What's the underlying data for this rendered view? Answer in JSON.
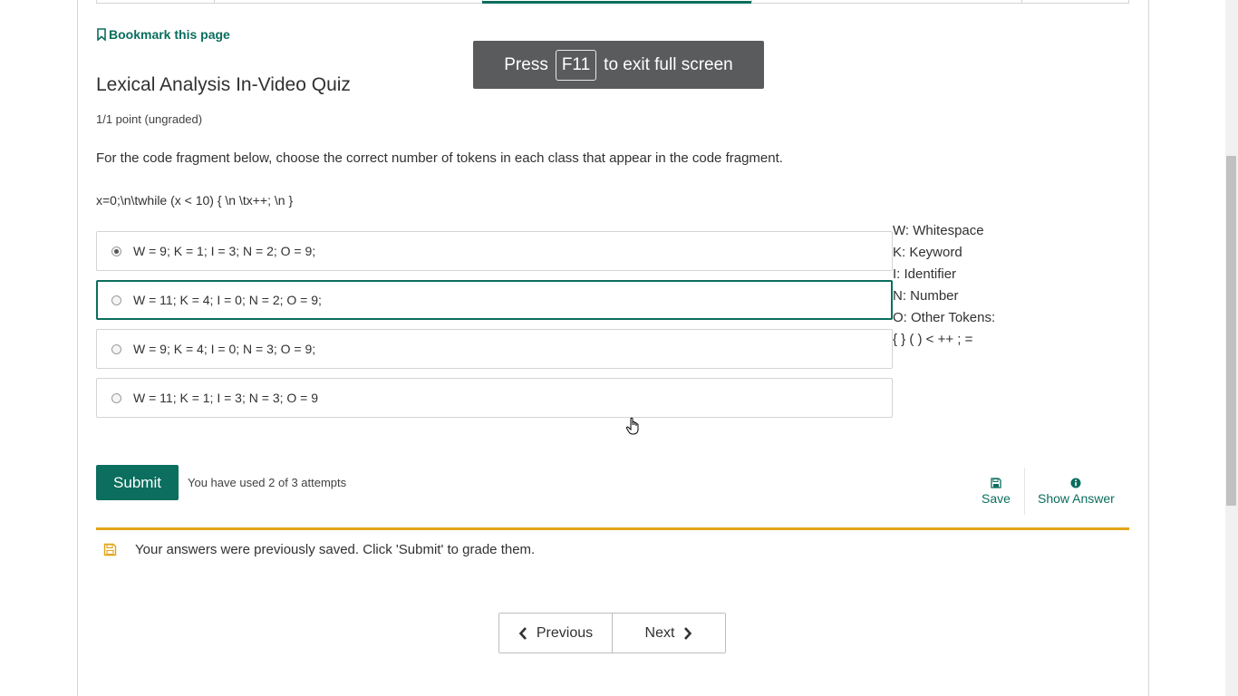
{
  "bookmark": {
    "label": "Bookmark this page"
  },
  "fullscreen_toast": {
    "before": "Press",
    "key": "F11",
    "after": "to exit full screen"
  },
  "quiz": {
    "title": "Lexical Analysis In-Video Quiz",
    "points": "1/1 point (ungraded)",
    "prompt": "For the code fragment below, choose the correct number of tokens in each class that appear in the code fragment.",
    "code": "x=0;\\n\\twhile (x < 10) { \\n \\tx++; \\n }",
    "options": [
      {
        "label": "W = 9; K = 1; I = 3; N = 2; O = 9;",
        "checked": true
      },
      {
        "label": "W = 11; K = 4; I = 0; N = 2; O = 9;",
        "checked": false
      },
      {
        "label": "W = 9; K = 4; I = 0; N = 3; O = 9;",
        "checked": false
      },
      {
        "label": "W = 11; K = 1; I = 3; N = 3; O = 9",
        "checked": false
      }
    ],
    "legend": [
      "W: Whitespace",
      "K: Keyword",
      "I: Identifier",
      "N: Number",
      "O: Other Tokens:",
      "{ } ( ) < ++ ; ="
    ]
  },
  "actions": {
    "submit_label": "Submit",
    "attempts_text": "You have used 2 of 3 attempts",
    "save_label": "Save",
    "show_answer_label": "Show Answer"
  },
  "notice": {
    "text": "Your answers were previously saved. Click 'Submit' to grade them."
  },
  "navigation": {
    "previous_label": "Previous",
    "next_label": "Next"
  },
  "colors": {
    "accent": "#0b6e5e",
    "warning": "#e2a418",
    "toast_bg": "#5a5b5d"
  },
  "icons": {
    "bookmark": "bookmark-icon",
    "save": "floppy-disk-icon",
    "show_answer": "info-circle-icon",
    "notice": "floppy-disk-icon",
    "previous": "chevron-left-icon",
    "next": "chevron-right-icon"
  }
}
